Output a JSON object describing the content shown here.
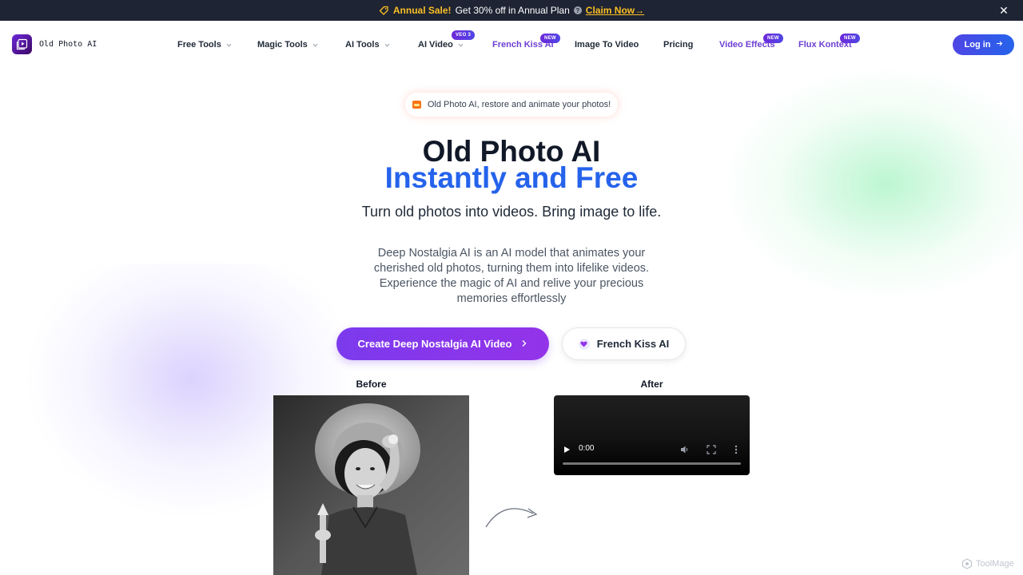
{
  "announcement": {
    "sale_label": "Annual Sale!",
    "message": "Get 30% off in Annual Plan",
    "claim_label": "Claim Now→"
  },
  "header": {
    "logo_text": "Old Photo AI",
    "nav": [
      {
        "label": "Free Tools",
        "dropdown": true
      },
      {
        "label": "Magic Tools",
        "dropdown": true
      },
      {
        "label": "AI Tools",
        "dropdown": true
      },
      {
        "label": "AI Video",
        "dropdown": true,
        "badge": "VEO 3"
      },
      {
        "label": "French Kiss AI",
        "badge": "NEW"
      },
      {
        "label": "Image To Video"
      },
      {
        "label": "Pricing"
      },
      {
        "label": "Video Effects",
        "badge": "NEW"
      },
      {
        "label": "Flux Kontext",
        "badge": "NEW"
      }
    ],
    "login_label": "Log in"
  },
  "hero": {
    "pill_text": "Old Photo AI, restore and animate your photos!",
    "title_line1": "Old Photo AI",
    "title_line2": "Instantly and Free",
    "subtitle": "Turn old photos into videos. Bring image to life.",
    "description": "Deep Nostalgia AI is an AI model that animates your cherished old photos, turning them into lifelike videos. Experience the magic of AI and relive your precious memories effortlessly",
    "primary_button": "Create Deep Nostalgia AI Video",
    "secondary_button": "French Kiss AI"
  },
  "comparison": {
    "before_label": "Before",
    "after_label": "After",
    "video_time": "0:00",
    "video_progress": 0
  },
  "watermark": "ToolMage",
  "colors": {
    "announcement_bg": "#1e2433",
    "sale_yellow": "#fbbf24",
    "accent_blue": "#2563eb",
    "accent_purple": "#7c3aed"
  }
}
